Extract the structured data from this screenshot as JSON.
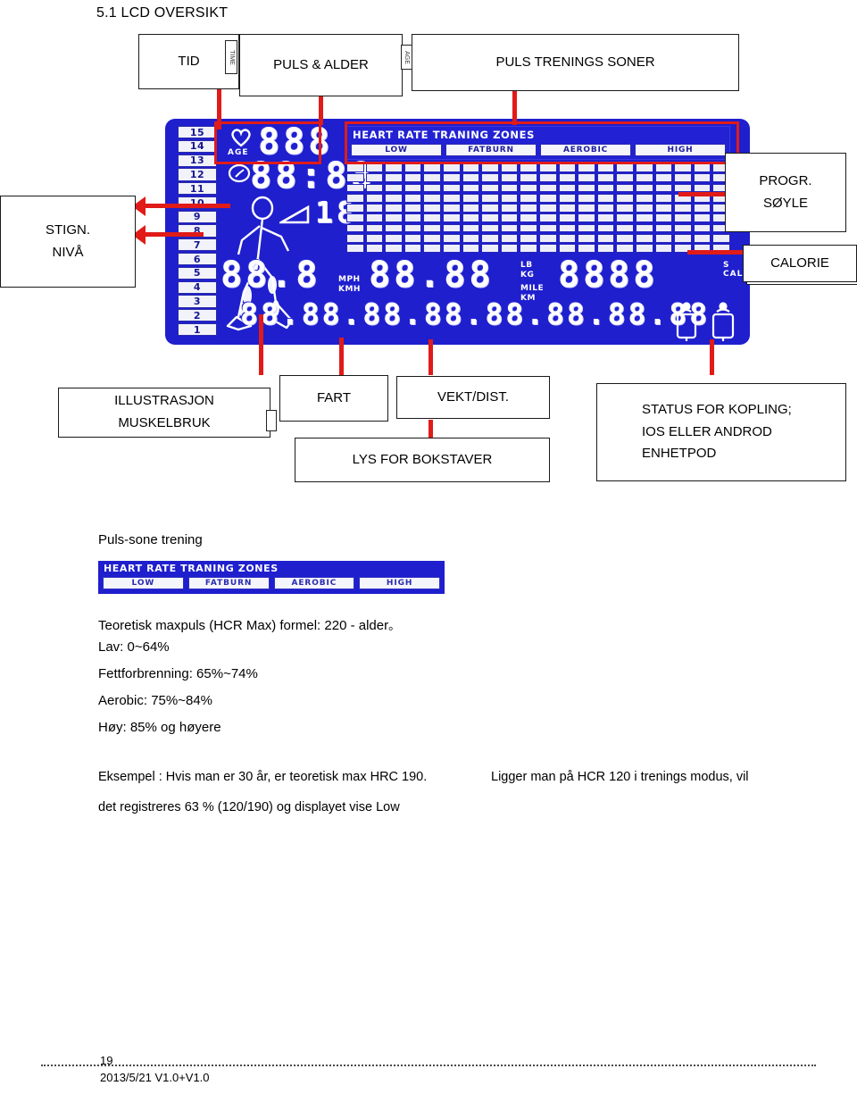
{
  "section": {
    "heading": "5.1 LCD OVERSIKT"
  },
  "callouts": {
    "tid": "TID",
    "puls_alder": "PULS & ALDER",
    "puls_soner": "PULS TRENINGS SONER",
    "progr_line1": "PROGR.",
    "progr_line2": "SØYLE",
    "calorie": "CALORIE",
    "stign_line1": "STIGN.",
    "stign_line2": "NIVÅ",
    "illustrasjon_line1": "ILLUSTRASJON",
    "illustrasjon_line2": "MUSKELBRUK",
    "fart": "FART",
    "vekt_dist": "VEKT/DIST.",
    "lys_bokstaver": "LYS FOR BOKSTAVER",
    "status_line1": "STATUS FOR KOPLING;",
    "status_line2": "IOS ELLER ANDROD",
    "status_line3": "ENHETPOD"
  },
  "connector_labels": {
    "tid": "TIME",
    "puls": "AGE"
  },
  "lcd": {
    "levels": [
      "15",
      "14",
      "13",
      "12",
      "11",
      "10",
      "9",
      "8",
      "7",
      "6",
      "5",
      "4",
      "3",
      "2",
      "1"
    ],
    "age_label": "AGE",
    "pulse_digits": "888",
    "time_digits": "88:88",
    "ramp_digits": "18",
    "zones_title": "HEART RATE TRANING ZONES",
    "zones": [
      "LOW",
      "FATBURN",
      "AEROBIC",
      "HIGH"
    ],
    "speed_digits": "88.8",
    "speed_units_top": "MPH",
    "speed_units_bottom": "KMH",
    "distance_digits": "88.88",
    "distance_units_top1": "LB",
    "distance_units_top2": "KG",
    "distance_units_bottom1": "MILE",
    "distance_units_bottom2": "KM",
    "calorie_digits": "8888",
    "side_units": "S CAL",
    "alnum_digits": "88.88.88.88.88.88.88.88",
    "grid_columns": 20,
    "grid_rows": 9
  },
  "body": {
    "subtitle": "Puls-sone trening",
    "legend_title": "HEART RATE TRANING ZONES",
    "legend_zones": [
      "LOW",
      "FATBURN",
      "AEROBIC",
      "HIGH"
    ],
    "formula": "Teoretisk maxpuls (HCR Max) formel: 220 - alder",
    "formula_suffix": "。",
    "zone_lines": [
      "Lav: 0~64%",
      "Fettforbrenning: 65%~74%",
      "Aerobic: 75%~84%",
      "Høy: 85% og høyere"
    ],
    "example_line1a": "Eksempel : Hvis man er 30 år, er teoretisk max HRC 190.",
    "example_line1b": "Ligger man på HCR 120 i trenings modus, vil",
    "example_line2": "det registreres 63 % (120/190) og displayet vise Low"
  },
  "footer": {
    "page_number": "19",
    "version": "2013/5/21 V1.0+V1.0"
  },
  "colors": {
    "lcd_blue": "#1f1fce",
    "leader_red": "#e01b18",
    "box_border": "#1a1a1a"
  }
}
